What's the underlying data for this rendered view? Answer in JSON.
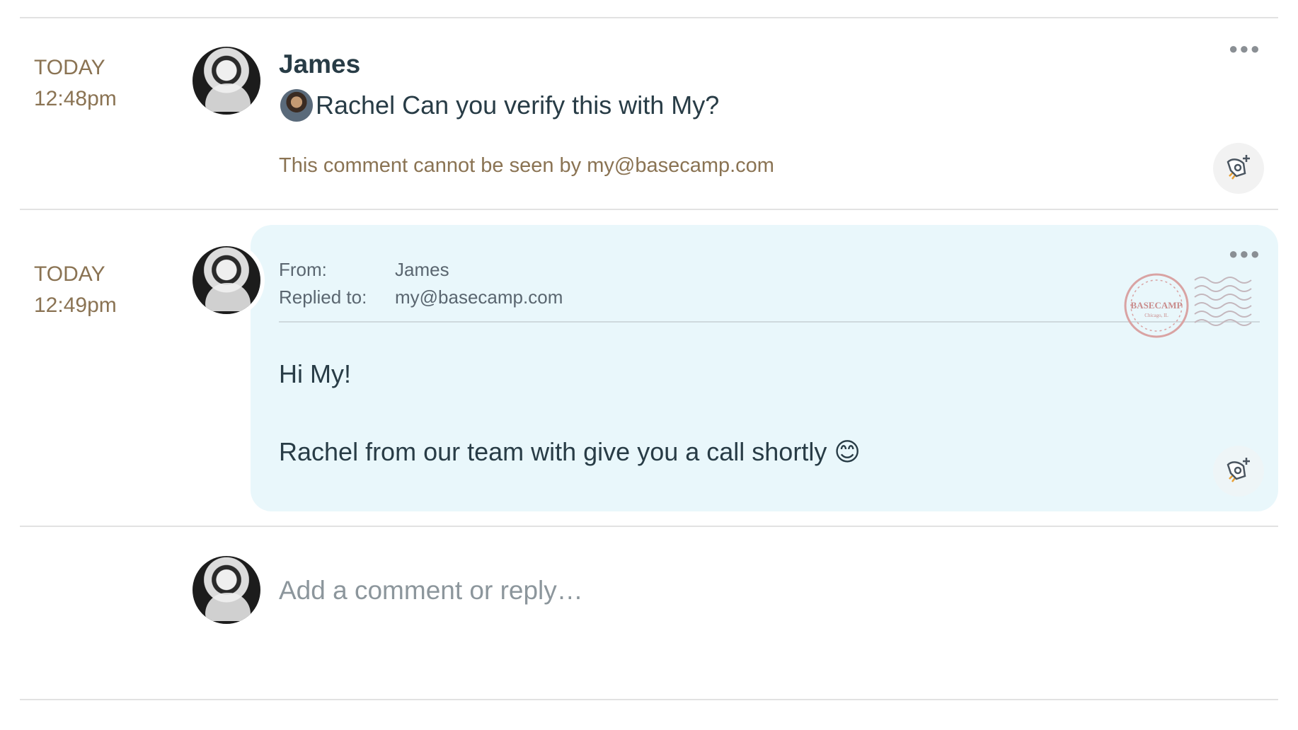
{
  "comments": [
    {
      "day": "TODAY",
      "time": "12:48pm",
      "author": "James",
      "mention": "Rachel",
      "text": "Can you verify this with My?",
      "visibility_note": "This comment cannot be seen by my@basecamp.com"
    },
    {
      "day": "TODAY",
      "time": "12:49pm",
      "from_label": "From:",
      "from_value": "James",
      "replied_label": "Replied to:",
      "replied_value": "my@basecamp.com",
      "greeting": "Hi My!",
      "body": "Rachel from our team with give you a call shortly 😊",
      "stamp_text": "BASECAMP",
      "stamp_subtext": "Chicago, IL"
    }
  ],
  "reply_box": {
    "placeholder": "Add a comment or reply…"
  },
  "icons": {
    "more": "ellipsis-icon",
    "boost": "rocket-boost-icon",
    "postmark": "postmark-stamp-icon"
  },
  "colors": {
    "timestamp": "#8a7353",
    "text": "#283c46",
    "email_card_bg": "#e9f7fb",
    "divider": "#e2e2e2"
  }
}
